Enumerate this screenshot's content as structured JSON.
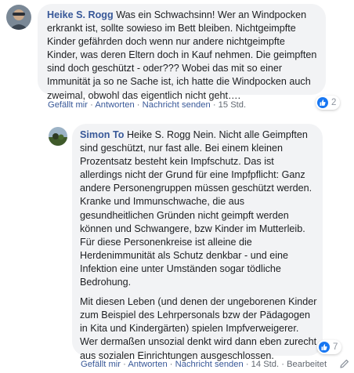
{
  "comment1": {
    "author": "Heike S. Rogg",
    "text": "Was ein Schwachsinn! Wer an Windpocken erkrankt ist, sollte sowieso im Bett bleiben. Nichtgeimpfte Kinder gefährden doch wenn nur andere nichtgeimpfte Kinder, was deren Eltern doch in Kauf nehmen. Die geimpften sind doch geschützt - oder??? Wobei das mit so einer Immunität ja so ne Sache ist, ich hatte die Windpocken auch zweimal, obwohl das eigentlich nicht geht….",
    "actions": {
      "like": "Gefällt mir",
      "reply": "Antworten",
      "message": "Nachricht senden",
      "time": "15 Std."
    },
    "reaction_count": "2"
  },
  "reply1": {
    "author": "Simon To",
    "paragraph1": "Heike S. Rogg Nein. Nicht alle Geimpften sind geschützt, nur fast alle. Bei einem kleinen Prozentsatz besteht kein Impfschutz. Das ist allerdings nicht der Grund für eine Impfpflicht: Ganz andere Personengruppen müssen geschützt werden. Kranke und Immunschwache, die aus gesundheitlichen Gründen nicht geimpft werden können und Schwangere, bzw Kinder im Mutterleib. Für diese Personenkreise ist alleine die Herdenimmunität als Schutz denkbar - und eine Infektion eine unter Umständen sogar tödliche Bedrohung.",
    "paragraph2": "Mit diesen Leben (und denen der ungeborenen Kinder zum Beispiel des Lehrpersonals bzw der Pädagogen in Kita und Kindergärten) spielen Impfverweigerer. Wer dermaßen unsozial denkt wird dann eben zurecht aus sozialen Einrichtungen ausgeschlossen.",
    "actions": {
      "like": "Gefällt mir",
      "reply": "Antworten",
      "message": "Nachricht senden",
      "time": "14 Std.",
      "edited": "Bearbeitet"
    },
    "reaction_count": "7"
  },
  "icons": {
    "reaction": "like-icon",
    "edit": "pencil-icon"
  },
  "colors": {
    "name": "#385898",
    "bubble": "#f2f3f5",
    "meta": "#606770",
    "like": "#1877f2"
  }
}
